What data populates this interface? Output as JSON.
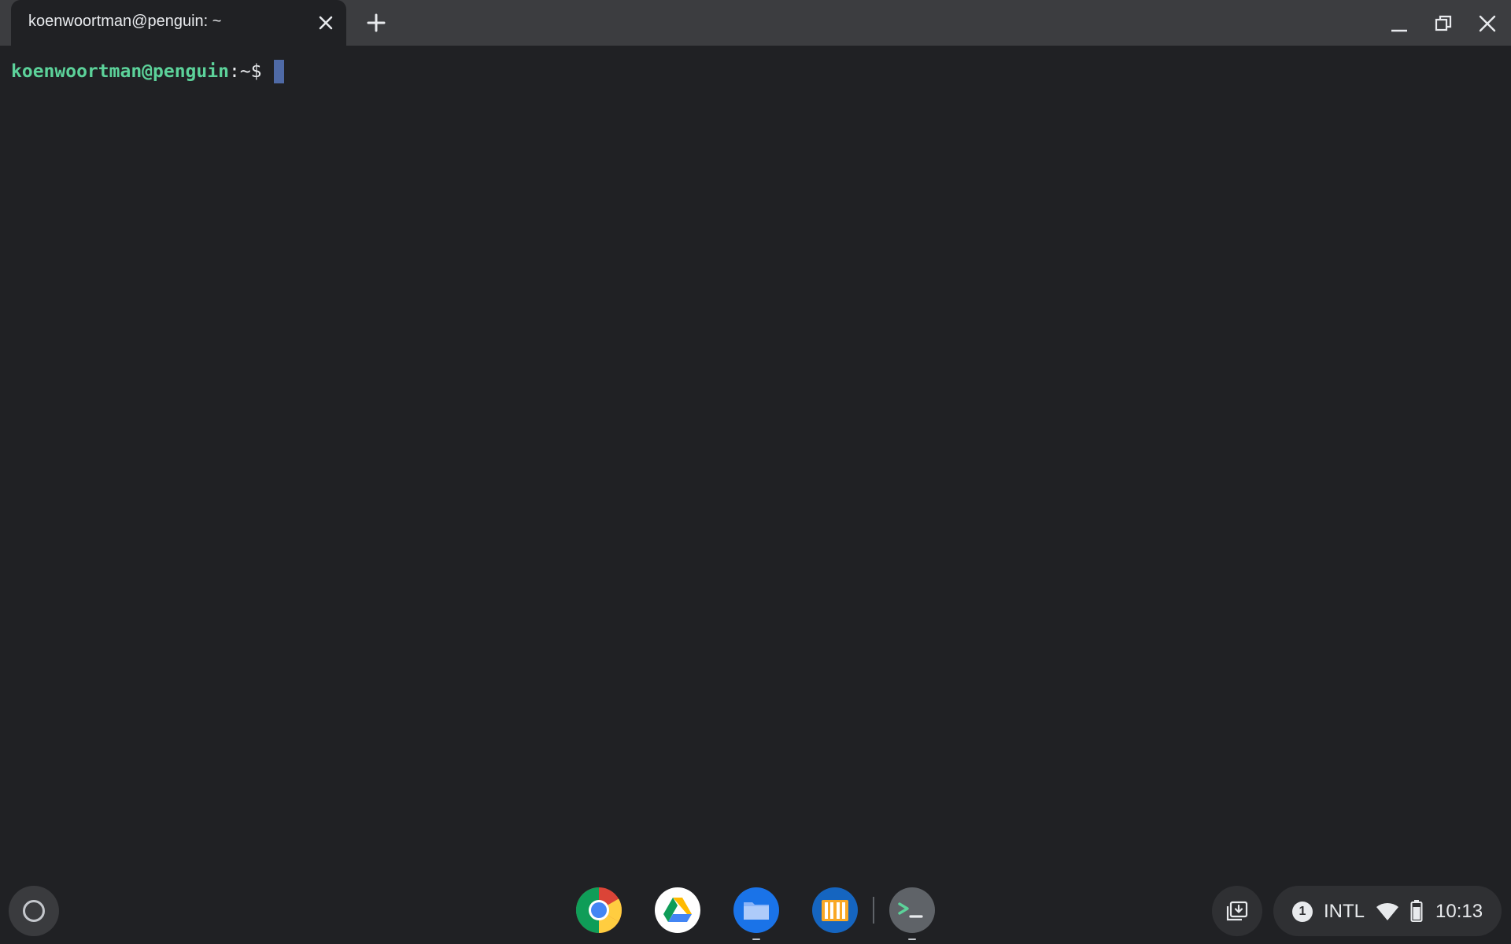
{
  "tab": {
    "title": "koenwoortman@penguin: ~"
  },
  "terminal": {
    "prompt_user": "koenwoortman@penguin",
    "prompt_sep": ":",
    "prompt_path": "~$ "
  },
  "shelf": {
    "apps": [
      "chrome-icon",
      "drive-icon",
      "files-icon",
      "books-icon",
      "terminal-icon"
    ],
    "terminal_glyph": ">_"
  },
  "tray": {
    "notification_count": "1",
    "ime": "INTL",
    "time": "10:13"
  },
  "colors": {
    "background": "#202124",
    "titlebar": "#3c3d40",
    "prompt_user": "#5cd29a",
    "cursor": "#4f6aa6"
  }
}
